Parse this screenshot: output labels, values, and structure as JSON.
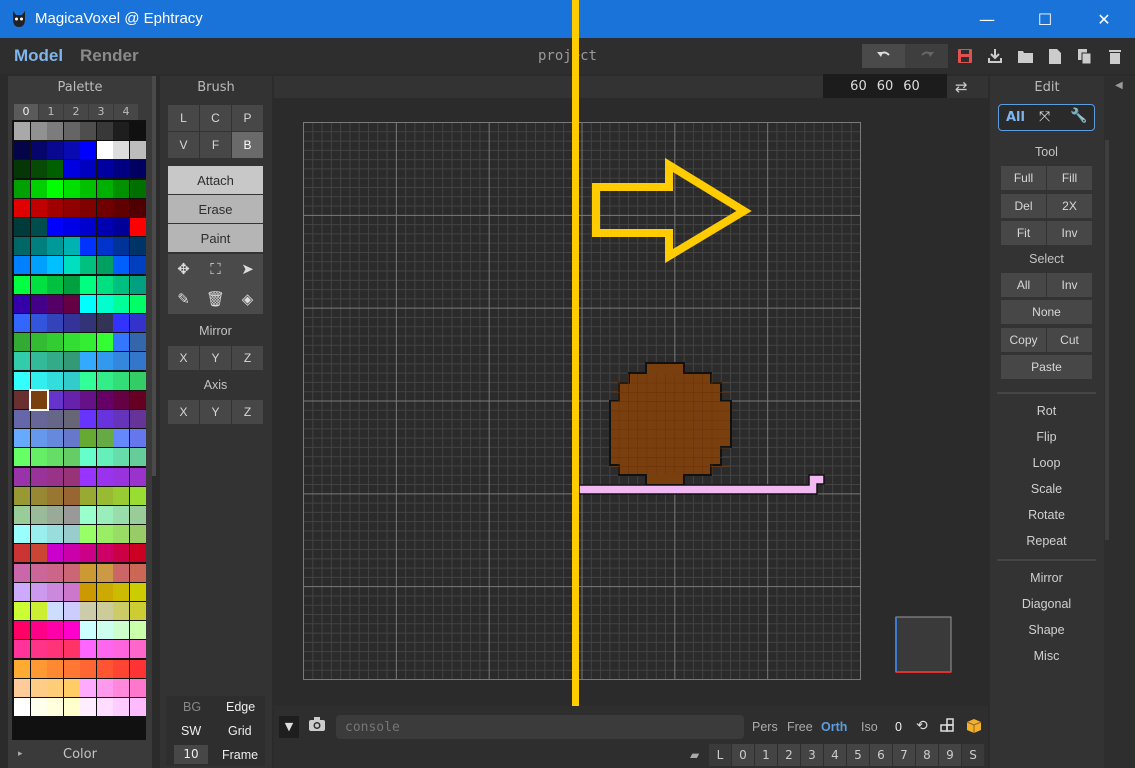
{
  "window": {
    "title": "MagicaVoxel @ Ephtracy",
    "minimize": "—",
    "maximize": "☐",
    "close": "✕"
  },
  "modes": {
    "model": "Model",
    "render": "Render"
  },
  "project_name": "project",
  "dimensions": {
    "x": "60",
    "y": "60",
    "z": "60"
  },
  "palette": {
    "title": "Palette",
    "tabs": [
      "0",
      "1",
      "2",
      "3",
      "4"
    ],
    "footer_label": "Color",
    "selected_color": "#7a3f0e",
    "rows": [
      [
        "#a9a9a9",
        "#919191",
        "#7c7c7c",
        "#656565",
        "#4e4e4e",
        "#383838",
        "#1e1e1e",
        "#101010"
      ],
      [
        "#040448",
        "#05056c",
        "#080890",
        "#0a0ab2",
        "#0000ff",
        "#ffffff",
        "#dddddd",
        "#bcbcbc"
      ],
      [
        "#063506",
        "#064a06",
        "#006000",
        "#0000e0",
        "#0000c0",
        "#0000a0",
        "#000080",
        "#000060"
      ],
      [
        "#00a000",
        "#00d000",
        "#00ff00",
        "#00e000",
        "#00c000",
        "#00b000",
        "#009000",
        "#007000"
      ],
      [
        "#e00000",
        "#c00000",
        "#a00000",
        "#900000",
        "#800000",
        "#700000",
        "#600000",
        "#500000"
      ],
      [
        "#003b3b",
        "#004d4d",
        "#0000ff",
        "#0000e6",
        "#0000cc",
        "#0000b3",
        "#000099",
        "#ff0000"
      ],
      [
        "#006666",
        "#007f7f",
        "#009999",
        "#00b3b3",
        "#0033ff",
        "#0033cc",
        "#003399",
        "#003366"
      ],
      [
        "#0080ff",
        "#00a0ff",
        "#00c0ff",
        "#00e0c0",
        "#00c080",
        "#00a060",
        "#0060ff",
        "#0040c0"
      ],
      [
        "#00ff40",
        "#00e040",
        "#00c040",
        "#00a040",
        "#00ff80",
        "#00e080",
        "#00c080",
        "#00a080"
      ],
      [
        "#3300aa",
        "#440088",
        "#550066",
        "#660044",
        "#00ffff",
        "#00ffcc",
        "#00ff99",
        "#00ff66"
      ],
      [
        "#3366ff",
        "#3355dd",
        "#3344bb",
        "#333399",
        "#333377",
        "#333355",
        "#3333ff",
        "#3333cc"
      ],
      [
        "#33aa33",
        "#33bb33",
        "#33cc33",
        "#33dd33",
        "#33ee33",
        "#33ff33",
        "#3377ff",
        "#3366aa"
      ],
      [
        "#33ccaa",
        "#33bb99",
        "#33aa88",
        "#339977",
        "#33aaff",
        "#3399ee",
        "#3388dd",
        "#3377cc"
      ],
      [
        "#33ffff",
        "#33eeee",
        "#33dddd",
        "#33cccc",
        "#33ff99",
        "#33ee88",
        "#33dd77",
        "#33cc66"
      ],
      [
        "#6a3030",
        "#7a3f0e",
        "#6633cc",
        "#6622aa",
        "#661188",
        "#660066",
        "#660044",
        "#660022"
      ],
      [
        "#6666aa",
        "#666699",
        "#666688",
        "#666677",
        "#6633ff",
        "#6633dd",
        "#6633bb",
        "#663399"
      ],
      [
        "#66aaff",
        "#6699ee",
        "#6688dd",
        "#6677cc",
        "#66aa33",
        "#66aa44",
        "#6688ff",
        "#6677ee"
      ],
      [
        "#66ff66",
        "#66ee66",
        "#66dd66",
        "#66cc66",
        "#66ffcc",
        "#66eebb",
        "#66ddaa",
        "#66cc99"
      ],
      [
        "#9933aa",
        "#993399",
        "#993388",
        "#993377",
        "#9933ff",
        "#9933ee",
        "#9933dd",
        "#9933cc"
      ],
      [
        "#999933",
        "#998833",
        "#997733",
        "#996633",
        "#99aa33",
        "#99bb33",
        "#99cc33",
        "#99dd33"
      ],
      [
        "#99cc99",
        "#99bb99",
        "#99aa99",
        "#999999",
        "#99ffcc",
        "#99eebb",
        "#99ddaa",
        "#99cc99"
      ],
      [
        "#99ffff",
        "#99eeee",
        "#99dddd",
        "#99cccc",
        "#99ff66",
        "#99ee66",
        "#99dd66",
        "#99cc66"
      ],
      [
        "#cc3333",
        "#cc4433",
        "#cc00cc",
        "#cc00aa",
        "#cc0088",
        "#cc0066",
        "#cc0044",
        "#cc0022"
      ],
      [
        "#cc66aa",
        "#cc6699",
        "#cc6688",
        "#cc6677",
        "#cc9933",
        "#cc9944",
        "#cc6666",
        "#cc6655"
      ],
      [
        "#ccaaff",
        "#cc99ee",
        "#cc88dd",
        "#cc77cc",
        "#cc9900",
        "#ccaa00",
        "#ccbb00",
        "#cccc00"
      ],
      [
        "#ccff33",
        "#ccee33",
        "#ccddff",
        "#ccccff",
        "#ccccaa",
        "#cccc99",
        "#cccc66",
        "#cccc33"
      ],
      [
        "#ff0066",
        "#ff0088",
        "#ff00aa",
        "#ff00cc",
        "#ccffff",
        "#ccffee",
        "#ccffcc",
        "#ccffaa"
      ],
      [
        "#ff3399",
        "#ff3388",
        "#ff3377",
        "#ff3366",
        "#ff66ff",
        "#ff66ee",
        "#ff66dd",
        "#ff66cc"
      ],
      [
        "#ffaa33",
        "#ff9933",
        "#ff8833",
        "#ff7733",
        "#ff6633",
        "#ff5533",
        "#ff4433",
        "#ff3333"
      ],
      [
        "#ffcc99",
        "#ffcc88",
        "#ffcc77",
        "#ffcc66",
        "#ffaaff",
        "#ff99ee",
        "#ff88dd",
        "#ff77cc"
      ],
      [
        "#ffffff",
        "#ffffee",
        "#ffffdd",
        "#ffffcc",
        "#ffeeff",
        "#ffddff",
        "#ffccff",
        "#ffbbff"
      ]
    ]
  },
  "brush": {
    "title": "Brush",
    "types": [
      "L",
      "C",
      "P",
      "V",
      "F",
      "B"
    ],
    "selected_type": "B",
    "modes": [
      "Attach",
      "Erase",
      "Paint"
    ],
    "selected_mode": "Attach",
    "tool_icons": [
      "move-icon",
      "select-box-icon",
      "cursor-arrow-icon",
      "eyedropper-icon",
      "trash-icon",
      "fill-bucket-icon"
    ],
    "mirror_title": "Mirror",
    "axis_title": "Axis",
    "axes": [
      "X",
      "Y",
      "Z"
    ]
  },
  "bottom_left": {
    "bg": "BG",
    "edge": "Edge",
    "sw": "SW",
    "grid": "Grid",
    "frame_value": "10",
    "frame": "Frame"
  },
  "edit": {
    "title": "Edit",
    "tabs": [
      "All",
      "expand-icon",
      "wrench-icon"
    ],
    "tool_title": "Tool",
    "tool_buttons": [
      "Full",
      "Fill",
      "Del",
      "2X",
      "Fit",
      "Inv"
    ],
    "select_title": "Select",
    "select_buttons": [
      "All",
      "Inv"
    ],
    "select_none": "None",
    "copy": "Copy",
    "cut": "Cut",
    "paste": "Paste",
    "actions": [
      "Rot",
      "Flip",
      "Loop",
      "Scale",
      "Rotate",
      "Repeat"
    ],
    "more": [
      "Mirror",
      "Diagonal",
      "Shape",
      "Misc"
    ]
  },
  "viewport": {
    "console_placeholder": "console",
    "views": [
      "Pers",
      "Free",
      "Orth",
      "Iso"
    ],
    "active_view": "Orth",
    "zero": "0",
    "frames": [
      "L",
      "0",
      "1",
      "2",
      "3",
      "4",
      "5",
      "6",
      "7",
      "8",
      "9",
      "S"
    ]
  },
  "colors": {
    "titlebar": "#1a73d9",
    "accent_blue": "#5b9ee0",
    "overlay_yellow": "#ffcc00",
    "voxel_brown": "#7a3f0e",
    "voxel_pink": "#f2b8f2"
  }
}
